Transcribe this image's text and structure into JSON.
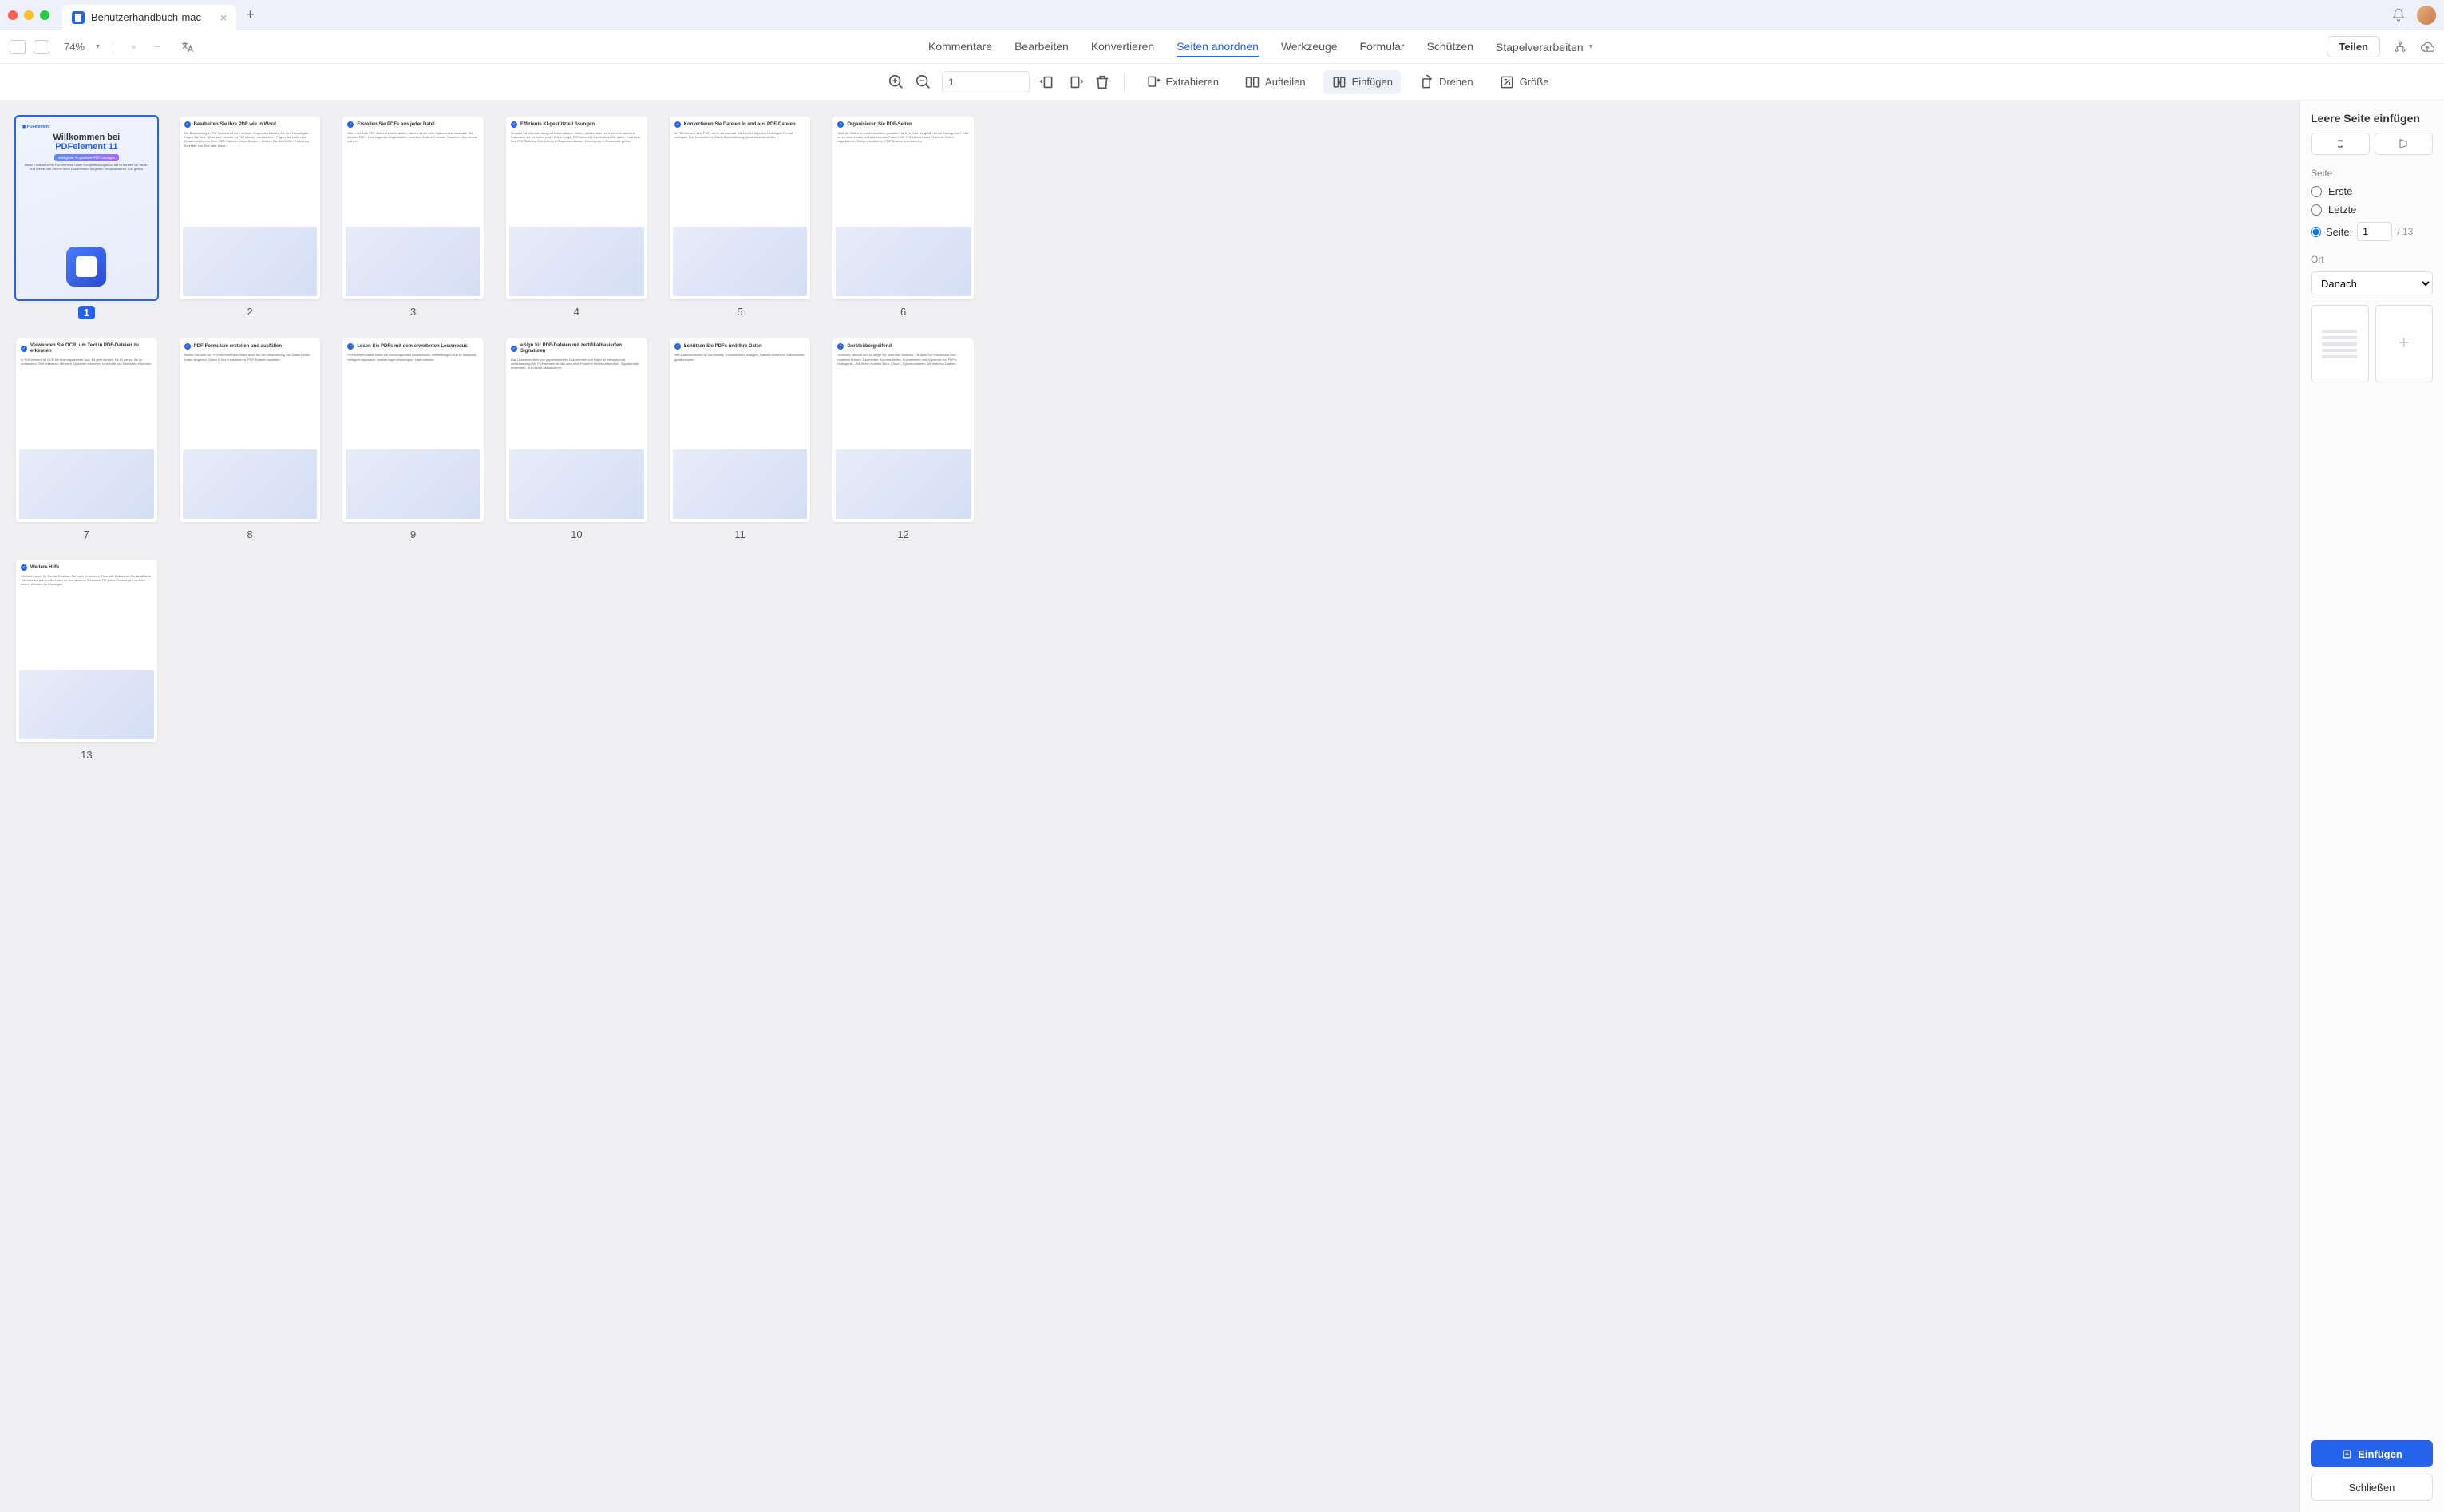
{
  "tab": {
    "title": "Benutzerhandbuch-mac"
  },
  "zoom": {
    "percent": "74%"
  },
  "menu": {
    "comments": "Kommentare",
    "edit": "Bearbeiten",
    "convert": "Konvertieren",
    "arrange": "Seiten anordnen",
    "tools": "Werkzeuge",
    "form": "Formular",
    "protect": "Schützen",
    "batch": "Stapelverarbeiten"
  },
  "share": "Teilen",
  "toolbar": {
    "page": "1",
    "extract": "Extrahieren",
    "split": "Aufteilen",
    "insert": "Einfügen",
    "rotate": "Drehen",
    "size": "Größe"
  },
  "pages": [
    {
      "n": "1",
      "selected": true,
      "title_a": "Willkommen bei",
      "title_b": "PDFelement 11",
      "badge": "Intelligente, KI-gestützte PDF-Lösungen",
      "sub": "Hallo! Entdecken Sie PDFelement, unser Komplettlösungstool. Mit KI können wir die Art und Weise, wie Sie mit Ihren Dokumenten umgehen, revolutionieren. Los geht's!"
    },
    {
      "n": "2",
      "title": "Bearbeiten Sie Ihre PDF wie in Word",
      "body": "Die Bearbeitung in PDFelement ist sehr einfach. Folgendes können Sie tun: Hinzufügen – Fügen Sie Text, Bilder und Formen zu PDFs hinzu. Verknüpfen – Fügen Sie Links und Wasserzeichen zu Ihren PDF-Dateien hinzu. Ändern – Ändern Sie die Größe, Farbe und Schriftart von Text oder Links."
    },
    {
      "n": "3",
      "title": "Erstellen Sie PDFs aus jeder Datei",
      "body": "Wenn Sie eine PDF-Datei erstellen wollen, stehen Ihnen viele Optionen zur Auswahl. Sie können PDFs über folgende Möglichkeiten erstellen: Andere Formate, Scannen, Von Grund auf neu."
    },
    {
      "n": "4",
      "title": "Effiziente KI-gestützte Lösungen",
      "body": "Müssen Sie mitunter dringend Informationen finden, wissen aber nicht mehr, in welchem Dokument sie zu finden sind? Keine Sorge, PDFelement KI unterstützt Sie dabei. Chat über Ihre PDF-Dateien, Extrahieren & Zusammenfassen, Übersetzen & Grammatik prüfen."
    },
    {
      "n": "5",
      "title": "Konvertieren Sie Dateien in und aus PDF-Dateien",
      "body": "In PDFelement sind PDFs mehr als nur das. Sie können in jedem beliebigen Format vorliegen. Frei konvertieren, Batch-Konvertierung, Qualität sicherstellen."
    },
    {
      "n": "6",
      "title": "Organisieren Sie PDF-Seiten",
      "body": "Sind die Seiten zu unübersichtlich gestaltet? Ist Ihre Datei zu groß, um sie freizugeben? Gibt es zu viele Inhalte und keinen roten Faden? Mit PDFelement kein Problem! Seiten organisieren, Seiten extrahieren, PDF-Dateien zuschneiden."
    },
    {
      "n": "7",
      "title": "Verwenden Sie OCR, um Text in PDF-Dateien zu erkennen",
      "body": "In PDFelement ist OCR ein leistungsstarkes Tool. Es geht schnell. Es ist genau. Es ist umfassend. Text erkennen, Mehrere Sprachen erkennen, Innerhalb von Sekunden erkennen."
    },
    {
      "n": "8",
      "title": "PDF-Formulare erstellen und ausfüllen",
      "body": "Stellen Sie sich vor! PDFelement kann Ihnen auch bei der Verarbeitung von Daten helfen. Daten eingeben, Daten in Excel extrahieren, PDF-Dateien ausfüllen."
    },
    {
      "n": "9",
      "title": "Lesen Sie PDFs mit dem erweiterten Lesemodus",
      "body": "PDFelement bietet Ihnen ein hervorragendes Leseerlebnis. Anmerkungen und KI-Assistent, Helligkeit anpassen, Markierungen hinzufügen, Laut vorlesen."
    },
    {
      "n": "10",
      "title": "eSign für PDF-Dateien mit zertifikatbasierten Signaturen",
      "body": "Das Unterschreiben von papierbasierten Dokumenten von Hand ist mühsam und zeitaufwendig! Mit PDFelement ist das alles kein Problem! Rechtsverbindlich, Signaturstile anwenden, In Echtzeit aktualisieren."
    },
    {
      "n": "11",
      "title": "Schützen Sie PDFs und Ihre Daten",
      "body": "Ihre Datensicherheit ist uns wichtig. Kennwörter hinzufügen, Dateien schützen, Datenschutz gewährleisten."
    },
    {
      "n": "12",
      "title": "Geräteübergreifend",
      "body": "Jederzeit, überall und so lange Sie möchten. Desktop – Nutzen Sie Funktionen zum nahtlosen Lesen, Bearbeiten, Kommentieren, Konvertieren und Signieren von PDFs. Mobilgerät – Mit Ihrem mobilen Büro. Cloud – Synchronisieren Sie mühelos Dateien."
    },
    {
      "n": "13",
      "title": "Weitere Hilfe",
      "body": "Wir sind immer für Sie da. Erfahren Sie mehr in unseren Tutorials. Entdecken Sie detaillierte Tutorials auf pdf.wondershare.de und anderen Websites. Für jedes Produkt gibt es auch einen Leitfaden für Einsteiger."
    }
  ],
  "panel": {
    "title": "Leere Seite einfügen",
    "section_page": "Seite",
    "radio_first": "Erste",
    "radio_last": "Letzte",
    "radio_page": "Seite:",
    "page_value": "1",
    "page_total": "/  13",
    "section_location": "Ort",
    "location_value": "Danach",
    "btn_insert": "Einfügen",
    "btn_close": "Schließen"
  }
}
